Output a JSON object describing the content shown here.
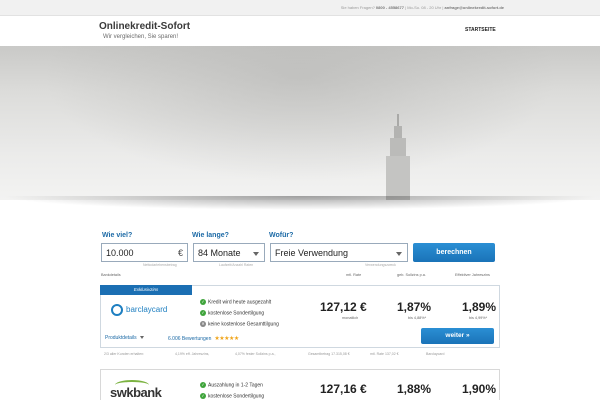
{
  "topbar": {
    "question": "Sie haben Fragen?",
    "phone": "0800 - 4558677",
    "hours": "| Mo-So. 08 - 20 Uhr |",
    "email": "anfrage@onlinekredit-sofort.de"
  },
  "header": {
    "title": "Onlinekredit-Sofort",
    "tagline": "Wir vergleichen, Sie sparen!",
    "nav_start": "STARTSEITE"
  },
  "form": {
    "amount_label": "Wie viel?",
    "amount_value": "10.000",
    "amount_unit": "€",
    "amount_hint": "Nettodarlehensbetrag",
    "term_label": "Wie lange?",
    "term_value": "84 Monate",
    "term_hint": "Laufzeit/Anzahl Raten",
    "purpose_label": "Wofür?",
    "purpose_value": "Freie Verwendung",
    "purpose_hint": "Verwendungszweck",
    "submit_label": "berechnen"
  },
  "columns": {
    "bank": "Bankdetails",
    "rate": "mtl. Rate",
    "sollzins": "geb. Sollzins p.a.",
    "effzins": "Effektiver Jahreszins"
  },
  "offers": [
    {
      "badge": "Exklusivzins",
      "bank": "barclaycard",
      "features": [
        {
          "icon": "check-icon",
          "text": "Kredit wird heute ausgezahlt"
        },
        {
          "icon": "check-icon",
          "text": "kostenlose Sondertilgung"
        },
        {
          "icon": "cross-icon",
          "text": "keine kostenlose Gesamttilgung"
        }
      ],
      "details_link": "Produktdetails",
      "reviews": "6.006 Bewertungen",
      "rate": "127,12 €",
      "rate_sub": "monatlich",
      "sollzins": "1,87%",
      "sollzins_sub": "bis 4,88%*",
      "effzins": "1,89%",
      "effzins_sub": "bis 4,99%*",
      "cta": "weiter »",
      "footer": [
        "2/3 aller Kunden erhalten:",
        "4,19% eff. Jahreszins,",
        "4,07% fester Sollzins p.a.,",
        "Gesamtbetrag 17.315,08 €",
        "mtl. Rate 137,02 €",
        "Barclaycard"
      ]
    },
    {
      "bank": "swkbank",
      "features": [
        {
          "icon": "check-icon",
          "text": "Auszahlung in 1-2 Tagen"
        },
        {
          "icon": "check-icon",
          "text": "kostenlose Sondertilgung"
        }
      ],
      "rate": "127,16 €",
      "sollzins": "1,88%",
      "effzins": "1,90%"
    }
  ],
  "colors": {
    "accent": "#1b6fb3",
    "button": "#1a73b8",
    "check": "#3fa43b",
    "star": "#f0a51c"
  }
}
